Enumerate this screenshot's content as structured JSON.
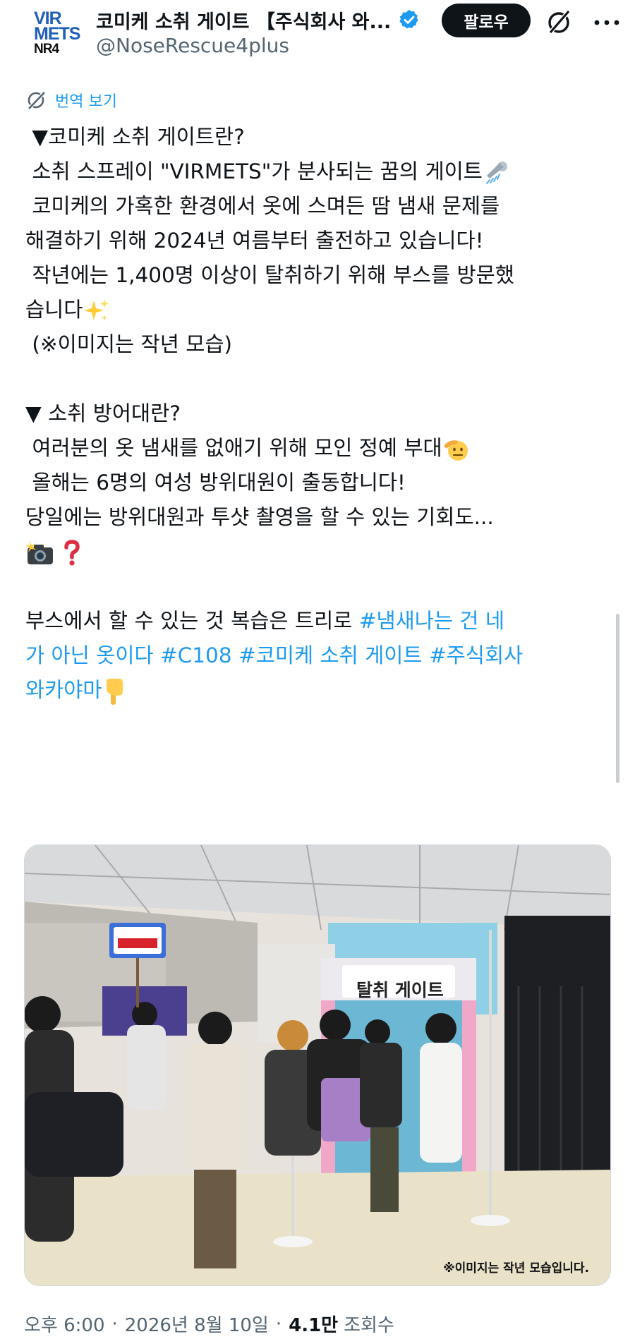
{
  "header": {
    "logo": {
      "line1": "VIR",
      "line2": "METS",
      "line3": "NR4"
    },
    "display_name": "코미케 소취 게이트 【주식회사 와...",
    "handle": "@NoseRescue4plus",
    "follow_label": "팔로우"
  },
  "translate": {
    "label": "번역 보기"
  },
  "tweet": {
    "lines": [
      "▼코미케 소취 게이트란?",
      "소취 스프레이 \"VIRMETS\"가 분사되는 꿈의 게이트",
      "코미케의 가혹한 환경에서 옷에 스며든 땀 냄새 문제를",
      "해결하기 위해 2024년 여름부터 출전하고 있습니다!",
      "작년에는 1,400명 이상이 탈취하기 위해 부스를 방문했",
      "습니다",
      "(※이미지는 작년 모습)",
      "",
      "▼ 소취 방어대란?",
      "여러분의 옷 냄새를 없애기 위해 모인 정예 부대",
      "올해는 6명의 여성 방위대원이 출동합니다!",
      "당일에는 방위대원과 투샷 촬영을 할 수 있는 기회도...",
      "",
      "",
      "부스에서 할 수 있는 것 복습은 트리로 "
    ],
    "hashtags": [
      "#냄새나는 건 네",
      "가 아닌 옷이다 #C108 #코미케 소취 게이트 #주식회사",
      "와카야마"
    ]
  },
  "photo": {
    "sign_text": "탈취 게이트",
    "caption": "※이미지는 작년 모습입니다."
  },
  "meta": {
    "time": "오후 6:00",
    "date": "2026년 8월 10일",
    "views_count": "4.1만",
    "views_label": "조회수"
  },
  "icons": [
    "verified-badge-icon",
    "grok-icon",
    "more-icon",
    "translate-icon",
    "shower-emoji",
    "sparkles-emoji",
    "saluting-face-emoji",
    "camera-flash-emoji",
    "question-mark-emoji",
    "pointing-down-emoji"
  ],
  "colors": {
    "link": "#1d9bf0",
    "text": "#0f1419",
    "muted": "#536471",
    "follow_bg": "#0f1419"
  }
}
